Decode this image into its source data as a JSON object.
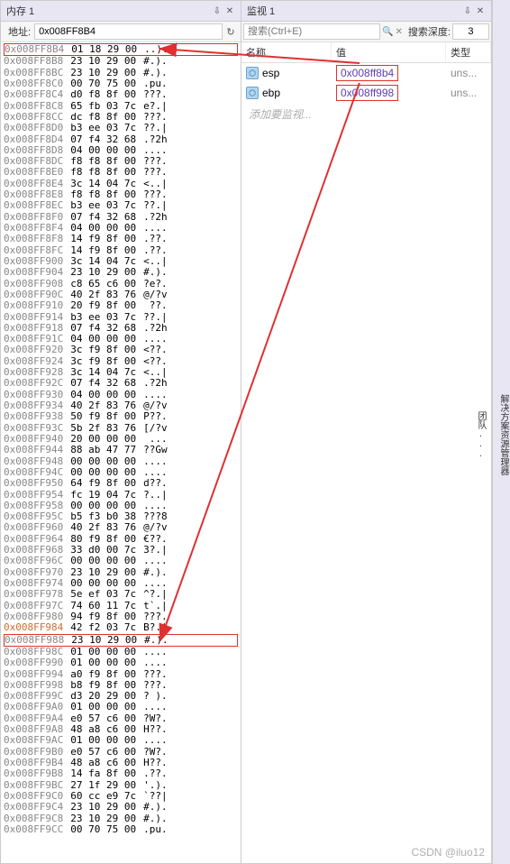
{
  "memory_panel": {
    "title": "内存 1",
    "pin_glyph": "⇩",
    "close_glyph": "✕",
    "address_label": "地址:",
    "address_value": "0x008FF8B4",
    "refresh_glyph": "↻",
    "rows": [
      {
        "addr": "0x008FF8B4",
        "bytes": "01 18 29 00",
        "ascii": "..).",
        "hl": true
      },
      {
        "addr": "0x008FF8B8",
        "bytes": "23 10 29 00",
        "ascii": "#.)."
      },
      {
        "addr": "0x008FF8BC",
        "bytes": "23 10 29 00",
        "ascii": "#.)."
      },
      {
        "addr": "0x008FF8C0",
        "bytes": "00 70 75 00",
        "ascii": ".pu."
      },
      {
        "addr": "0x008FF8C4",
        "bytes": "d0 f8 8f 00",
        "ascii": "???."
      },
      {
        "addr": "0x008FF8C8",
        "bytes": "65 fb 03 7c",
        "ascii": "e?.|"
      },
      {
        "addr": "0x008FF8CC",
        "bytes": "dc f8 8f 00",
        "ascii": "???."
      },
      {
        "addr": "0x008FF8D0",
        "bytes": "b3 ee 03 7c",
        "ascii": "??.|"
      },
      {
        "addr": "0x008FF8D4",
        "bytes": "07 f4 32 68",
        "ascii": ".?2h"
      },
      {
        "addr": "0x008FF8D8",
        "bytes": "04 00 00 00",
        "ascii": "...."
      },
      {
        "addr": "0x008FF8DC",
        "bytes": "f8 f8 8f 00",
        "ascii": "???."
      },
      {
        "addr": "0x008FF8E0",
        "bytes": "f8 f8 8f 00",
        "ascii": "???."
      },
      {
        "addr": "0x008FF8E4",
        "bytes": "3c 14 04 7c",
        "ascii": "<..|"
      },
      {
        "addr": "0x008FF8E8",
        "bytes": "f8 f8 8f 00",
        "ascii": "???."
      },
      {
        "addr": "0x008FF8EC",
        "bytes": "b3 ee 03 7c",
        "ascii": "??.|"
      },
      {
        "addr": "0x008FF8F0",
        "bytes": "07 f4 32 68",
        "ascii": ".?2h"
      },
      {
        "addr": "0x008FF8F4",
        "bytes": "04 00 00 00",
        "ascii": "...."
      },
      {
        "addr": "0x008FF8F8",
        "bytes": "14 f9 8f 00",
        "ascii": ".??."
      },
      {
        "addr": "0x008FF8FC",
        "bytes": "14 f9 8f 00",
        "ascii": ".??."
      },
      {
        "addr": "0x008FF900",
        "bytes": "3c 14 04 7c",
        "ascii": "<..|"
      },
      {
        "addr": "0x008FF904",
        "bytes": "23 10 29 00",
        "ascii": "#.)."
      },
      {
        "addr": "0x008FF908",
        "bytes": "c8 65 c6 00",
        "ascii": "?e?."
      },
      {
        "addr": "0x008FF90C",
        "bytes": "40 2f 83 76",
        "ascii": "@/?v"
      },
      {
        "addr": "0x008FF910",
        "bytes": "20 f9 8f 00",
        "ascii": " ??."
      },
      {
        "addr": "0x008FF914",
        "bytes": "b3 ee 03 7c",
        "ascii": "??.|"
      },
      {
        "addr": "0x008FF918",
        "bytes": "07 f4 32 68",
        "ascii": ".?2h"
      },
      {
        "addr": "0x008FF91C",
        "bytes": "04 00 00 00",
        "ascii": "...."
      },
      {
        "addr": "0x008FF920",
        "bytes": "3c f9 8f 00",
        "ascii": "<??."
      },
      {
        "addr": "0x008FF924",
        "bytes": "3c f9 8f 00",
        "ascii": "<??."
      },
      {
        "addr": "0x008FF928",
        "bytes": "3c 14 04 7c",
        "ascii": "<..|"
      },
      {
        "addr": "0x008FF92C",
        "bytes": "07 f4 32 68",
        "ascii": ".?2h"
      },
      {
        "addr": "0x008FF930",
        "bytes": "04 00 00 00",
        "ascii": "...."
      },
      {
        "addr": "0x008FF934",
        "bytes": "40 2f 83 76",
        "ascii": "@/?v"
      },
      {
        "addr": "0x008FF938",
        "bytes": "50 f9 8f 00",
        "ascii": "P??."
      },
      {
        "addr": "0x008FF93C",
        "bytes": "5b 2f 83 76",
        "ascii": "[/?v"
      },
      {
        "addr": "0x008FF940",
        "bytes": "20 00 00 00",
        "ascii": " ..."
      },
      {
        "addr": "0x008FF944",
        "bytes": "88 ab 47 77",
        "ascii": "??Gw"
      },
      {
        "addr": "0x008FF948",
        "bytes": "00 00 00 00",
        "ascii": "...."
      },
      {
        "addr": "0x008FF94C",
        "bytes": "00 00 00 00",
        "ascii": "...."
      },
      {
        "addr": "0x008FF950",
        "bytes": "64 f9 8f 00",
        "ascii": "d??."
      },
      {
        "addr": "0x008FF954",
        "bytes": "fc 19 04 7c",
        "ascii": "?..|"
      },
      {
        "addr": "0x008FF958",
        "bytes": "00 00 00 00",
        "ascii": "...."
      },
      {
        "addr": "0x008FF95C",
        "bytes": "b5 f3 b0 38",
        "ascii": "???8"
      },
      {
        "addr": "0x008FF960",
        "bytes": "40 2f 83 76",
        "ascii": "@/?v"
      },
      {
        "addr": "0x008FF964",
        "bytes": "80 f9 8f 00",
        "ascii": "€??."
      },
      {
        "addr": "0x008FF968",
        "bytes": "33 d0 00 7c",
        "ascii": "3?.|"
      },
      {
        "addr": "0x008FF96C",
        "bytes": "00 00 00 00",
        "ascii": "...."
      },
      {
        "addr": "0x008FF970",
        "bytes": "23 10 29 00",
        "ascii": "#.)."
      },
      {
        "addr": "0x008FF974",
        "bytes": "00 00 00 00",
        "ascii": "...."
      },
      {
        "addr": "0x008FF978",
        "bytes": "5e ef 03 7c",
        "ascii": "^?.|"
      },
      {
        "addr": "0x008FF97C",
        "bytes": "74 60 11 7c",
        "ascii": "t`.|"
      },
      {
        "addr": "0x008FF980",
        "bytes": "94 f9 8f 00",
        "ascii": "???."
      },
      {
        "addr": "0x008FF984",
        "bytes": "42 f2 03 7c",
        "ascii": "B?.|",
        "hl_addr": true
      },
      {
        "addr": "0x008FF988",
        "bytes": "23 10 29 00",
        "ascii": "#.).",
        "hl": true
      },
      {
        "addr": "0x008FF98C",
        "bytes": "01 00 00 00",
        "ascii": "...."
      },
      {
        "addr": "0x008FF990",
        "bytes": "01 00 00 00",
        "ascii": "...."
      },
      {
        "addr": "0x008FF994",
        "bytes": "a0 f9 8f 00",
        "ascii": "???."
      },
      {
        "addr": "0x008FF998",
        "bytes": "b8 f9 8f 00",
        "ascii": "???."
      },
      {
        "addr": "0x008FF99C",
        "bytes": "d3 20 29 00",
        "ascii": "? )."
      },
      {
        "addr": "0x008FF9A0",
        "bytes": "01 00 00 00",
        "ascii": "...."
      },
      {
        "addr": "0x008FF9A4",
        "bytes": "e0 57 c6 00",
        "ascii": "?W?."
      },
      {
        "addr": "0x008FF9A8",
        "bytes": "48 a8 c6 00",
        "ascii": "H??."
      },
      {
        "addr": "0x008FF9AC",
        "bytes": "01 00 00 00",
        "ascii": "...."
      },
      {
        "addr": "0x008FF9B0",
        "bytes": "e0 57 c6 00",
        "ascii": "?W?."
      },
      {
        "addr": "0x008FF9B4",
        "bytes": "48 a8 c6 00",
        "ascii": "H??."
      },
      {
        "addr": "0x008FF9B8",
        "bytes": "14 fa 8f 00",
        "ascii": ".??."
      },
      {
        "addr": "0x008FF9BC",
        "bytes": "27 1f 29 00",
        "ascii": "'.)."
      },
      {
        "addr": "0x008FF9C0",
        "bytes": "60 cc e9 7c",
        "ascii": "`??|"
      },
      {
        "addr": "0x008FF9C4",
        "bytes": "23 10 29 00",
        "ascii": "#.)."
      },
      {
        "addr": "0x008FF9C8",
        "bytes": "23 10 29 00",
        "ascii": "#.)."
      },
      {
        "addr": "0x008FF9CC",
        "bytes": "00 70 75 00",
        "ascii": ".pu."
      }
    ]
  },
  "watch_panel": {
    "title": "监视 1",
    "pin_glyph": "⇩",
    "close_glyph": "✕",
    "search_placeholder": "搜索(Ctrl+E)",
    "search_icon": "🔍",
    "clear_icon": "✕",
    "depth_label": "搜索深度:",
    "depth_value": "3",
    "columns": {
      "name": "名称",
      "value": "值",
      "type": "类型"
    },
    "rows": [
      {
        "name": "esp",
        "value": "0x008ff8b4",
        "type": "uns..."
      },
      {
        "name": "ebp",
        "value": "0x008ff998",
        "type": "uns..."
      }
    ],
    "add_placeholder": "添加要监视..."
  },
  "side_tabs": [
    "解决方案资源管理器",
    "团队..."
  ],
  "watermark": "CSDN @iluo12"
}
